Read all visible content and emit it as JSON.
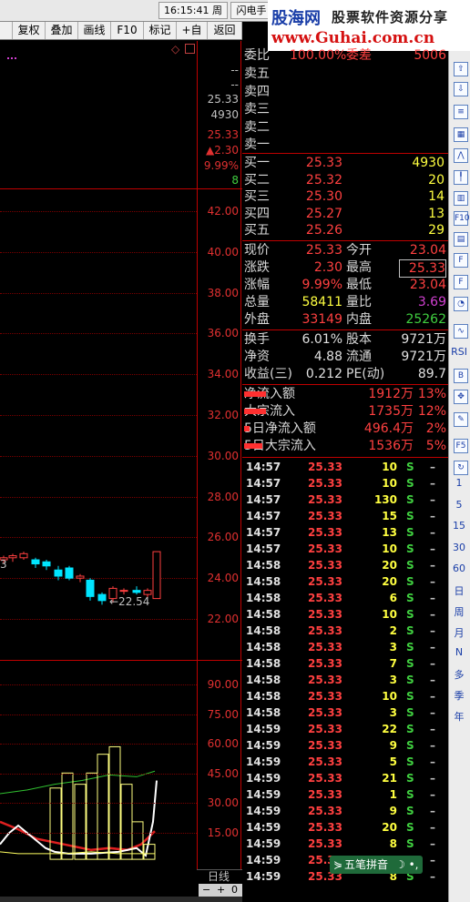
{
  "topbar": {
    "clock": "16:15:41 周二",
    "flash": "闪电手"
  },
  "banner": {
    "brand1": "股海网",
    "brand2": "股票软件资源分享",
    "brand3": "www.Guhai.com.cn"
  },
  "toolbar": {
    "items": [
      "复权",
      "叠加",
      "画线",
      "F10",
      "标记",
      "+自选",
      "返回"
    ]
  },
  "price_axis": {
    "labels": [
      "42.00",
      "40.00",
      "38.00",
      "36.00",
      "34.00",
      "32.00",
      "30.00",
      "28.00",
      "26.00",
      "24.00",
      "22.00"
    ]
  },
  "indicator_axis": {
    "labels": [
      "90.00",
      "75.00",
      "60.00",
      "45.00",
      "30.00",
      "15.00"
    ]
  },
  "info_column": {
    "values": [
      "--",
      "--",
      "25.33",
      "4930",
      "25.33",
      "▲2.30",
      "9.99%",
      "8"
    ]
  },
  "low_label": "←22.54",
  "left_edge_label": "3",
  "period_bar": {
    "label": "日线",
    "minus": "−",
    "plus": "+",
    "zero": "0"
  },
  "order_book": {
    "weibi_label": "委比",
    "weibi_value": "100.00%",
    "weicha_label": "委差",
    "weicha_value": "5006",
    "sells": [
      {
        "label": "卖五"
      },
      {
        "label": "卖四"
      },
      {
        "label": "卖三"
      },
      {
        "label": "卖二"
      },
      {
        "label": "卖一"
      }
    ],
    "buys": [
      {
        "label": "买一",
        "price": "25.33",
        "vol": "4930"
      },
      {
        "label": "买二",
        "price": "25.32",
        "vol": "20"
      },
      {
        "label": "买三",
        "price": "25.30",
        "vol": "14"
      },
      {
        "label": "买四",
        "price": "25.27",
        "vol": "13"
      },
      {
        "label": "买五",
        "price": "25.26",
        "vol": "29"
      }
    ]
  },
  "quote": {
    "rows": [
      {
        "l1": "现价",
        "v1": "25.33",
        "l2": "今开",
        "v2": "23.04"
      },
      {
        "l1": "涨跌",
        "v1": "2.30",
        "l2": "最高",
        "v2": "25.33"
      },
      {
        "l1": "涨幅",
        "v1": "9.99%",
        "l2": "最低",
        "v2": "23.04"
      },
      {
        "l1": "总量",
        "v1": "58411",
        "l2": "量比",
        "v2": "3.69"
      },
      {
        "l1": "外盘",
        "v1": "33149",
        "l2": "内盘",
        "v2": "25262"
      }
    ]
  },
  "fundamentals": {
    "rows": [
      {
        "l1": "换手",
        "v1": "6.01%",
        "l2": "股本",
        "v2": "9721万"
      },
      {
        "l1": "净资",
        "v1": "4.88",
        "l2": "流通",
        "v2": "9721万"
      },
      {
        "l1": "收益(三)",
        "v1": "0.212",
        "l2": "PE(动)",
        "v2": "89.7"
      }
    ]
  },
  "flows": {
    "rows": [
      {
        "label": "净流入额",
        "value": "1912万",
        "pct": "13%"
      },
      {
        "label": "大宗流入",
        "value": "1735万",
        "pct": "12%"
      },
      {
        "label": "5日净流入额",
        "value": "496.4万",
        "pct": "2%"
      },
      {
        "label": "5日大宗流入",
        "value": "1536万",
        "pct": "5%"
      }
    ]
  },
  "trades": [
    {
      "t": "14:57",
      "p": "25.33",
      "v": "10",
      "s": "S"
    },
    {
      "t": "14:57",
      "p": "25.33",
      "v": "10",
      "s": "S"
    },
    {
      "t": "14:57",
      "p": "25.33",
      "v": "130",
      "s": "S"
    },
    {
      "t": "14:57",
      "p": "25.33",
      "v": "15",
      "s": "S"
    },
    {
      "t": "14:57",
      "p": "25.33",
      "v": "13",
      "s": "S"
    },
    {
      "t": "14:57",
      "p": "25.33",
      "v": "10",
      "s": "S"
    },
    {
      "t": "14:58",
      "p": "25.33",
      "v": "20",
      "s": "S"
    },
    {
      "t": "14:58",
      "p": "25.33",
      "v": "20",
      "s": "S"
    },
    {
      "t": "14:58",
      "p": "25.33",
      "v": "6",
      "s": "S"
    },
    {
      "t": "14:58",
      "p": "25.33",
      "v": "10",
      "s": "S"
    },
    {
      "t": "14:58",
      "p": "25.33",
      "v": "2",
      "s": "S"
    },
    {
      "t": "14:58",
      "p": "25.33",
      "v": "3",
      "s": "S"
    },
    {
      "t": "14:58",
      "p": "25.33",
      "v": "7",
      "s": "S"
    },
    {
      "t": "14:58",
      "p": "25.33",
      "v": "3",
      "s": "S"
    },
    {
      "t": "14:58",
      "p": "25.33",
      "v": "10",
      "s": "S"
    },
    {
      "t": "14:58",
      "p": "25.33",
      "v": "3",
      "s": "S"
    },
    {
      "t": "14:59",
      "p": "25.33",
      "v": "22",
      "s": "S"
    },
    {
      "t": "14:59",
      "p": "25.33",
      "v": "9",
      "s": "S"
    },
    {
      "t": "14:59",
      "p": "25.33",
      "v": "5",
      "s": "S"
    },
    {
      "t": "14:59",
      "p": "25.33",
      "v": "21",
      "s": "S"
    },
    {
      "t": "14:59",
      "p": "25.33",
      "v": "1",
      "s": "S"
    },
    {
      "t": "14:59",
      "p": "25.33",
      "v": "9",
      "s": "S"
    },
    {
      "t": "14:59",
      "p": "25.33",
      "v": "20",
      "s": "S"
    },
    {
      "t": "14:59",
      "p": "25.33",
      "v": "8",
      "s": "S"
    },
    {
      "t": "14:59",
      "p": "25.33",
      "v": "",
      "s": ""
    },
    {
      "t": "14:59",
      "p": "25.33",
      "v": "8",
      "s": "S"
    }
  ],
  "ime": {
    "label": "五笔拼音"
  },
  "sidebar": {
    "periods": [
      "1",
      "5",
      "15",
      "30",
      "60"
    ],
    "units": [
      "日",
      "周",
      "月",
      "N",
      "多",
      "季",
      "年"
    ],
    "rsi": "RSI",
    "f10": "F10",
    "f5": "F5"
  },
  "colors": {
    "up": "#ff4040",
    "down": "#00e5ff",
    "bg": "#000000",
    "grid": "#7a0000",
    "green": "#40d040",
    "yellow": "#ffff40"
  }
}
